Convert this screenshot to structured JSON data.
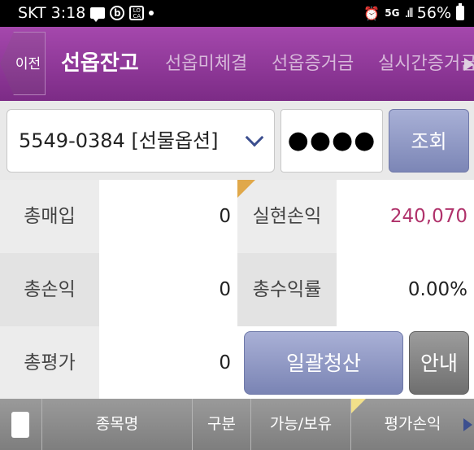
{
  "status_bar": {
    "carrier": "SKT",
    "time": "3:18",
    "network": "5G",
    "battery": "56%",
    "loca_icon_text": "LOCA"
  },
  "tabs": {
    "prev_label": "이전",
    "items": [
      {
        "label": "선옵잔고",
        "active": true
      },
      {
        "label": "선옵미체결",
        "active": false
      },
      {
        "label": "선옵증거금",
        "active": false
      },
      {
        "label": "실시간증거금",
        "active": false
      }
    ]
  },
  "account": {
    "selected": "5549-0384 [선물옵션]",
    "password_mask": "●●●●",
    "inquiry_label": "조회"
  },
  "summary": {
    "total_purchase_label": "총매입",
    "total_purchase_value": "0",
    "realized_pnl_label": "실현손익",
    "realized_pnl_value": "240,070",
    "total_pnl_label": "총손익",
    "total_pnl_value": "0",
    "total_return_label": "총수익률",
    "total_return_value": "0.00%",
    "total_valuation_label": "총평가",
    "total_valuation_value": "0",
    "bulk_liquidate_label": "일괄청산",
    "guide_label": "안내"
  },
  "columns": {
    "name": "종목명",
    "type": "구분",
    "available_held": "가능/보유",
    "valuation_pnl": "평가손익"
  },
  "colors": {
    "tab_bg": "#8d3a96",
    "accent_button": "#8d96c4",
    "profit_text": "#b0326b"
  }
}
